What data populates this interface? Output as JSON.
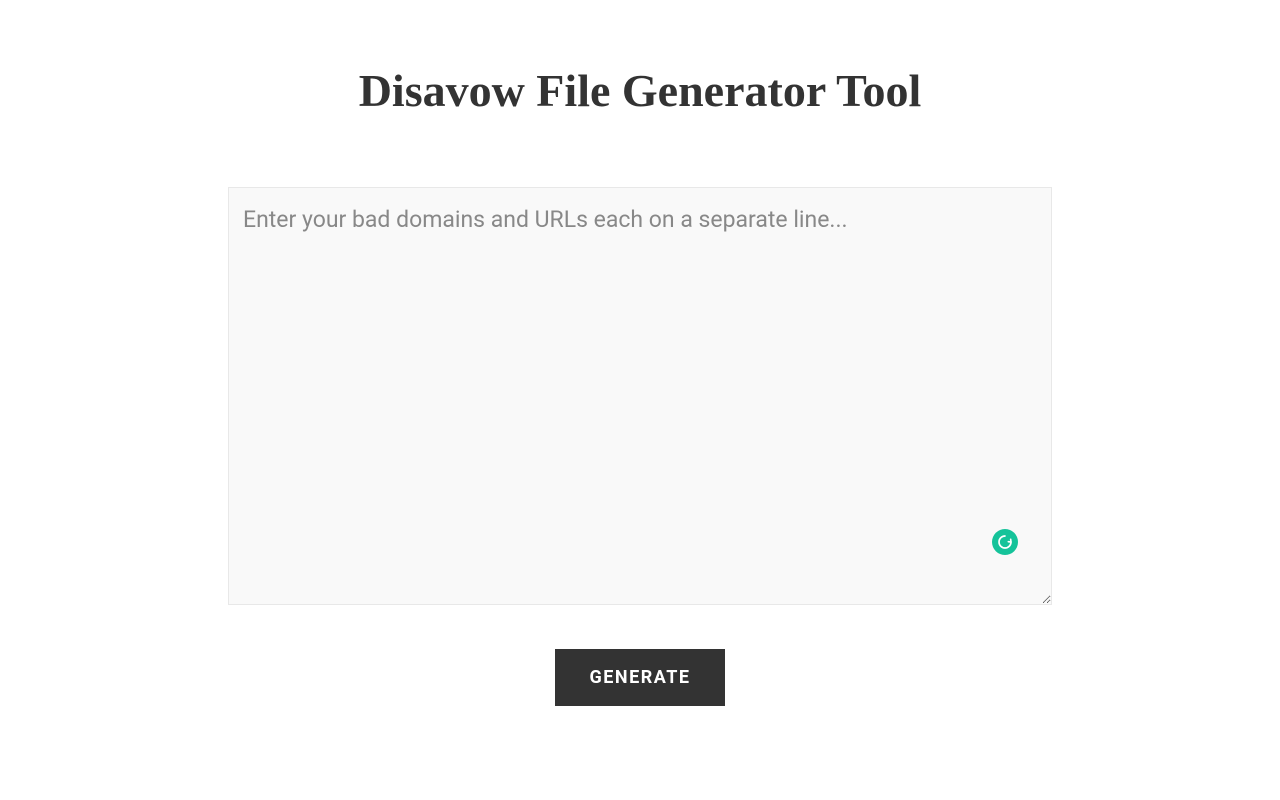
{
  "title": "Disavow File Generator Tool",
  "textarea": {
    "placeholder": "Enter your bad domains and URLs each on a separate line...",
    "value": ""
  },
  "button": {
    "label": "GENERATE"
  }
}
